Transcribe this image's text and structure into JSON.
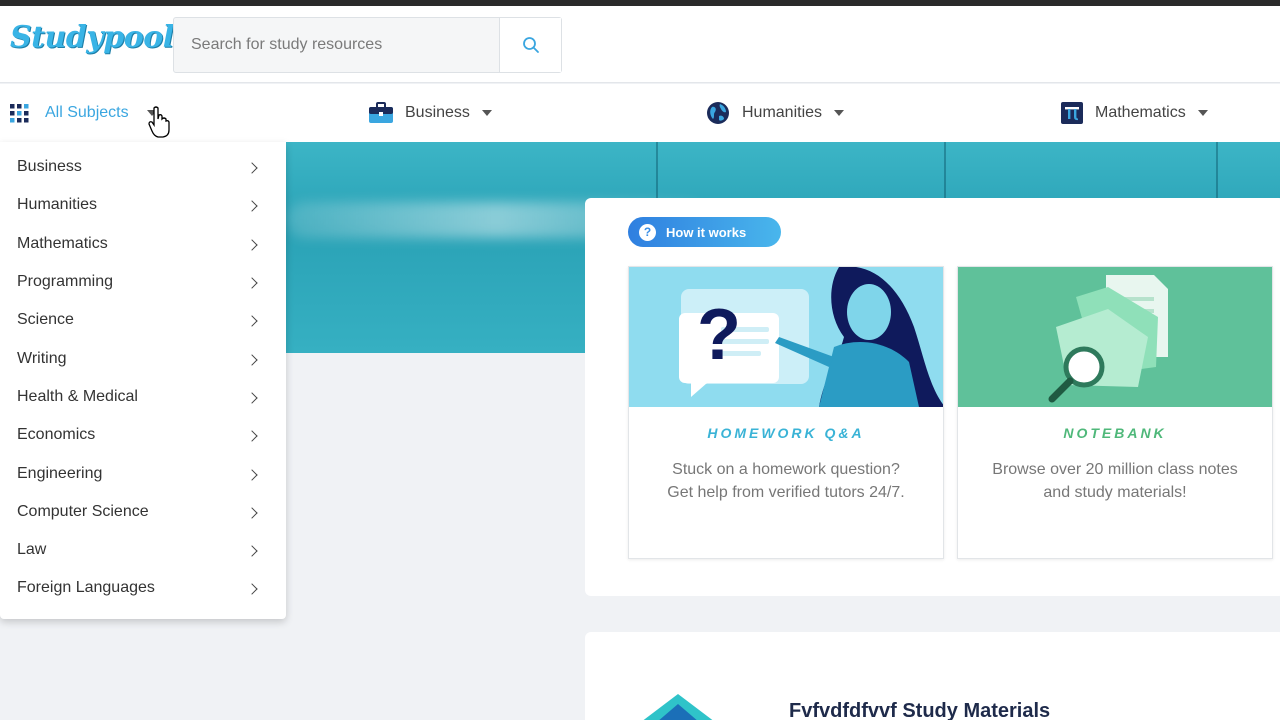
{
  "header": {
    "logo": "Studypool",
    "search_placeholder": "Search for study resources"
  },
  "subnav": {
    "all_subjects": "All Subjects",
    "items": [
      {
        "label": "Business",
        "icon": "briefcase-icon"
      },
      {
        "label": "Humanities",
        "icon": "globe-icon"
      },
      {
        "label": "Mathematics",
        "icon": "pi-icon"
      }
    ]
  },
  "dropdown": {
    "items": [
      "Business",
      "Humanities",
      "Mathematics",
      "Programming",
      "Science",
      "Writing",
      "Health & Medical",
      "Economics",
      "Engineering",
      "Computer Science",
      "Law",
      "Foreign Languages"
    ]
  },
  "main": {
    "how_it_works": "How it works",
    "features": [
      {
        "title": "HOMEWORK Q&A",
        "line1": "Stuck on a homework question?",
        "line2": "Get help from verified tutors 24/7.",
        "color": "#3ab3d6"
      },
      {
        "title": "NOTEBANK",
        "line1": "Browse over 20 million class notes",
        "line2": "and study materials!",
        "color": "#4fb87a"
      }
    ],
    "materials_heading": "Fvfvdfdfvvf Study Materials"
  },
  "colors": {
    "accent": "#3aa6e0",
    "hero": "#2aa2b6"
  }
}
